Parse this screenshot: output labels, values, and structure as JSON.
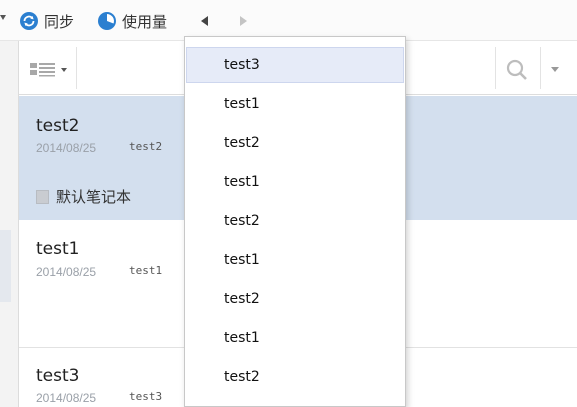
{
  "toolbar": {
    "sync_label": "同步",
    "usage_label": "使用量",
    "sync_icon": "sync-icon",
    "usage_icon": "usage-pie-icon",
    "back_icon": "back-arrow-icon",
    "forward_icon": "forward-arrow-icon",
    "accent_color": "#2b7fd0"
  },
  "list": {
    "view_icon": "list-view-icon",
    "search_icon": "search-icon",
    "selected_color": "#d3dfee",
    "notes": [
      {
        "title": "test2",
        "date": "2014/08/25",
        "snippet": "test2",
        "notebook": "默认笔记本"
      },
      {
        "title": "test1",
        "date": "2014/08/25",
        "snippet": "test1"
      },
      {
        "title": "test3",
        "date": "2014/08/25",
        "snippet": "test3"
      }
    ]
  },
  "history_menu": {
    "items": [
      "test3",
      "test1",
      "test2",
      "test1",
      "test2",
      "test1",
      "test2",
      "test1",
      "test2"
    ]
  }
}
